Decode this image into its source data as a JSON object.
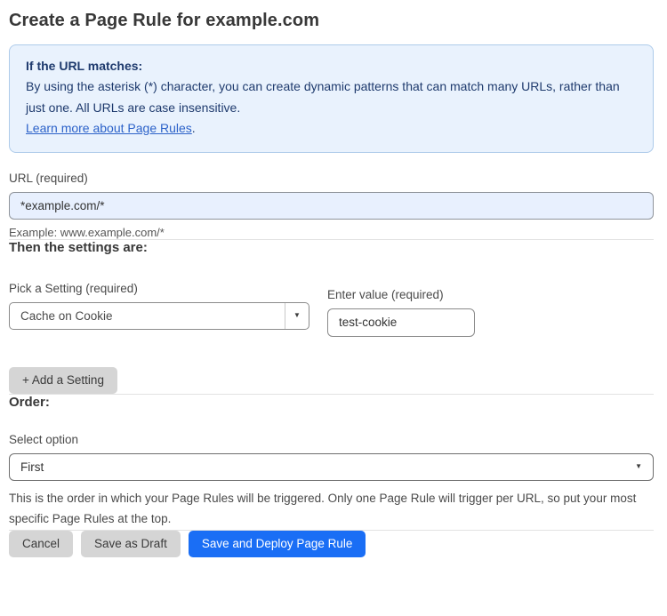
{
  "page": {
    "title": "Create a Page Rule for example.com"
  },
  "info_box": {
    "heading": "If the URL matches:",
    "body": "By using the asterisk (*) character, you can create dynamic patterns that can match many URLs, rather than just one. All URLs are case insensitive.",
    "link_label": "Learn more about Page Rules",
    "link_suffix": "."
  },
  "url_field": {
    "label": "URL (required)",
    "value": "*example.com/*",
    "helper": "Example: www.example.com/*"
  },
  "settings_section": {
    "heading": "Then the settings are:",
    "setting_select": {
      "label": "Pick a Setting (required)",
      "value": "Cache on Cookie"
    },
    "value_field": {
      "label": "Enter value (required)",
      "value": "test-cookie"
    },
    "add_setting_label": "+ Add a Setting"
  },
  "order_section": {
    "heading": "Order:",
    "select_label": "Select option",
    "select_value": "First",
    "helper": "This is the order in which your Page Rules will be triggered. Only one Page Rule will trigger per URL, so put your most specific Page Rules at the top."
  },
  "footer": {
    "cancel_label": "Cancel",
    "save_draft_label": "Save as Draft",
    "save_deploy_label": "Save and Deploy Page Rule"
  },
  "icons": {
    "dropdown_arrow": "▼"
  },
  "colors": {
    "accent_blue": "#1a6ef5",
    "info_background": "#e9f2fd",
    "info_border": "#aecbea",
    "info_text": "#1e3a6d",
    "link_blue": "#2c62c9",
    "url_input_background": "#e8f0fe",
    "button_gray": "#d5d5d5"
  }
}
